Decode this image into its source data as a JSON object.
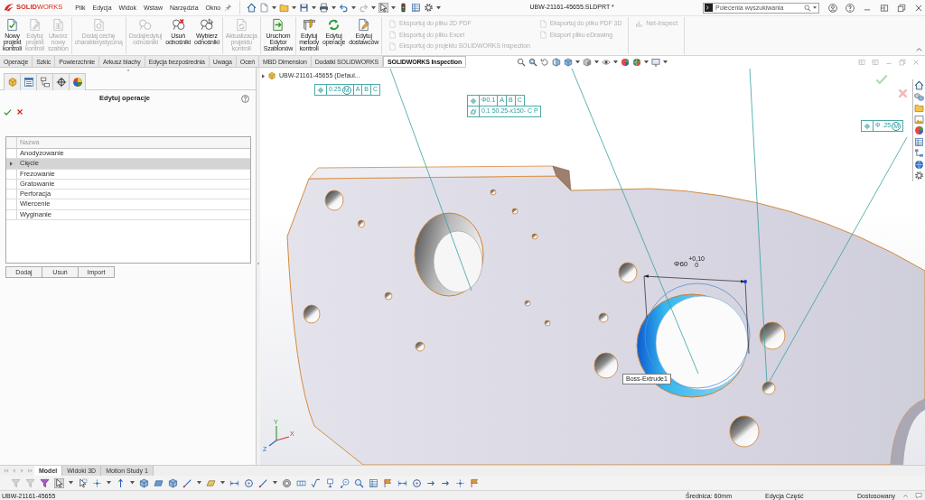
{
  "title_bar": {
    "logo": "**SOLID**WORKS",
    "menu": [
      "Plik",
      "Edycja",
      "Widok",
      "Wstaw",
      "Narzędzia",
      "Okno"
    ],
    "document_title": "UBW-21161-45655.SLDPRT *",
    "search": {
      "placeholder": "Polecenia wyszukiwania"
    }
  },
  "ribbon": {
    "groups": [
      {
        "buttons": [
          {
            "label": "Nowy\nprojekt\nkontroli",
            "disabled": false
          },
          {
            "label": "Edytuj\nprojekt\nkontroli",
            "disabled": true
          },
          {
            "label": "Utwórz\nnowy\nszablon",
            "disabled": true
          }
        ]
      },
      {
        "buttons": [
          {
            "label": "Dodaj cechę\ncharakterystyczną",
            "disabled": true
          }
        ]
      },
      {
        "buttons": [
          {
            "label": "Dodaj/edytuj\nodnośniki",
            "disabled": true
          },
          {
            "label": "Usuń\nodnośniki",
            "disabled": false
          },
          {
            "label": "Wybierz\nodnośniki",
            "disabled": false
          }
        ]
      },
      {
        "buttons": [
          {
            "label": "Aktualizacja\nprojektu\nkontroli",
            "disabled": true
          }
        ]
      },
      {
        "buttons": [
          {
            "label": "Uruchom\nEdytor\nSzablonów",
            "disabled": false
          }
        ]
      },
      {
        "buttons": [
          {
            "label": "Edytuj\nmetody\nkontroli",
            "disabled": false
          },
          {
            "label": "Edytuj\noperacje",
            "disabled": false
          },
          {
            "label": "Edytuj\ndostawców",
            "disabled": false
          }
        ]
      }
    ],
    "export_groups": [
      {
        "columns": [
          {
            "items": [
              {
                "label": "Eksportuj do pliku 2D PDF",
                "disabled": true
              },
              {
                "label": "Eksportuj do pliku Excel",
                "disabled": true
              },
              {
                "label": "Eksportuj do projektu SOLIDWORKS Inspection",
                "disabled": true
              }
            ]
          },
          {
            "items": [
              {
                "label": "Eksportuj do pliku PDF 3D",
                "disabled": true
              },
              {
                "label": "Eksport pliku eDrawing",
                "disabled": true
              }
            ]
          }
        ]
      },
      {
        "columns": [
          {
            "items": [
              {
                "label": "Net-Inspect",
                "disabled": true
              }
            ]
          }
        ]
      }
    ]
  },
  "tabs": [
    {
      "label": "Operacje",
      "selected": false
    },
    {
      "label": "Szkic",
      "selected": false
    },
    {
      "label": "Powierzchnie",
      "selected": false
    },
    {
      "label": "Arkusz blachy",
      "selected": false
    },
    {
      "label": "Edycja bezpośrednia",
      "selected": false
    },
    {
      "label": "Uwaga",
      "selected": false
    },
    {
      "label": "Oceń",
      "selected": false
    },
    {
      "label": "MBD Dimension",
      "selected": false
    },
    {
      "label": "Dodatki SOLIDWORKS",
      "selected": false
    },
    {
      "label": "SOLIDWORKS Inspection",
      "selected": true
    }
  ],
  "left_panel": {
    "title": "Edytuj operacje",
    "table": {
      "columns": [
        "Nazwa"
      ],
      "rows": [
        {
          "name": "Anodyzowanie",
          "selected": false
        },
        {
          "name": "Cięcie",
          "selected": true
        },
        {
          "name": "Frezowanie",
          "selected": false
        },
        {
          "name": "Gratowanie",
          "selected": false
        },
        {
          "name": "Perforacja",
          "selected": false
        },
        {
          "name": "Wiercenie",
          "selected": false
        },
        {
          "name": "Wyginanie",
          "selected": false
        }
      ]
    },
    "buttons": [
      "Dodaj",
      "Usuń",
      "Import"
    ]
  },
  "viewport": {
    "tree_item": {
      "label": "UBW-21161-45655 (Defaul...",
      "expanded": false
    },
    "gdt_frames": [
      {
        "rows": [
          {
            "kind": "position",
            "tolerance": "0.25",
            "modifier": "M",
            "datums": [
              "A",
              "B",
              "C"
            ]
          }
        ]
      },
      {
        "rows": [
          {
            "kind": "position",
            "tolerance": "Φ0.1",
            "datums": [
              "A",
              "B",
              "C"
            ]
          },
          {
            "kind": "cylindricity",
            "tolerance": "0.1 50.25-x150- C P"
          }
        ]
      },
      {
        "rows": [
          {
            "kind": "position",
            "tolerance": "Φ .25",
            "modifier": "M"
          }
        ]
      }
    ],
    "dimension": {
      "value": "Φ60",
      "tolerance_upper": "+0,10",
      "tolerance_lower": "0"
    },
    "tooltip": "Boss-Extrude1",
    "triad_labels": [
      "Y",
      "X",
      "Z"
    ]
  },
  "bottom_tabs": [
    {
      "label": "Model",
      "selected": true
    },
    {
      "label": "Widoki 3D",
      "selected": false
    },
    {
      "label": "Motion Study 1",
      "selected": false
    }
  ],
  "status_bar": {
    "file": "UBW-21161-45655",
    "measurement": "Średnica: 60mm",
    "mode": "Edycja Część",
    "units": "Dostosowany"
  }
}
